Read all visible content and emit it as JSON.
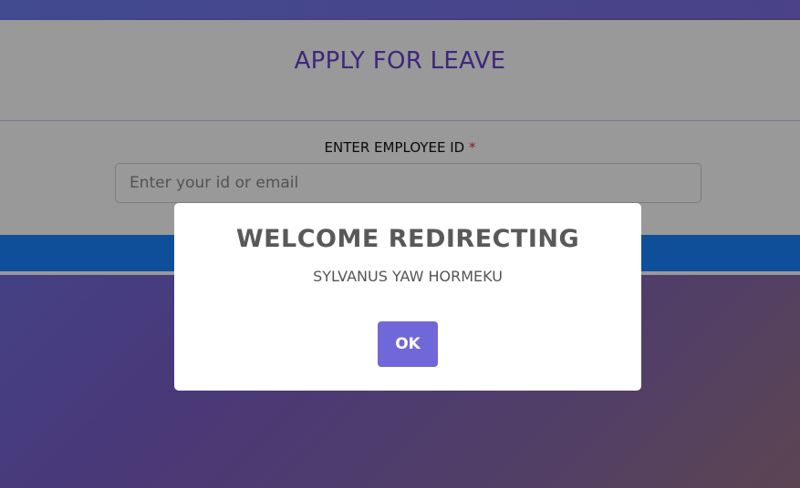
{
  "form": {
    "title": "APPLY FOR LEAVE",
    "employee_label": "ENTER EMPLOYEE ID",
    "required_marker": "*",
    "employee_input": {
      "value": "",
      "placeholder": "Enter your id or email"
    }
  },
  "dialog": {
    "title": "WELCOME REDIRECTING",
    "message": "SYLVANUS YAW HORMEKU",
    "ok_label": "OK"
  },
  "colors": {
    "title": "#6a3fd0",
    "submit_bar": "#1a84ff",
    "ok_button": "#7067d8",
    "required": "#d63b3b"
  }
}
